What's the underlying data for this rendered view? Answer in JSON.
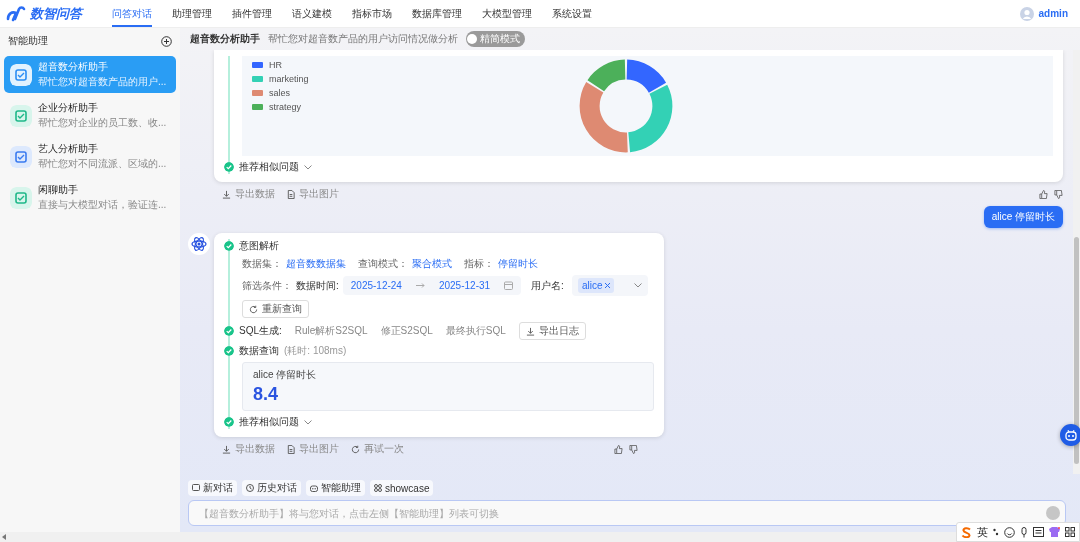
{
  "header": {
    "logo_text": "数智问答",
    "user": "admin",
    "nav": [
      {
        "label": "问答对话",
        "selected": true
      },
      {
        "label": "助理管理",
        "selected": false
      },
      {
        "label": "插件管理",
        "selected": false
      },
      {
        "label": "语义建模",
        "selected": false
      },
      {
        "label": "指标市场",
        "selected": false
      },
      {
        "label": "数据库管理",
        "selected": false
      },
      {
        "label": "大模型管理",
        "selected": false
      },
      {
        "label": "系统设置",
        "selected": false
      }
    ]
  },
  "sidebar": {
    "title": "智能助理",
    "items": [
      {
        "name": "超音数分析助手",
        "description": "帮忙您对超音数产品的用户...",
        "selected": true
      },
      {
        "name": "企业分析助手",
        "description": "帮忙您对企业的员工数、收...",
        "selected": false
      },
      {
        "name": "艺人分析助手",
        "description": "帮忙您对不同流派、区域的...",
        "selected": false
      },
      {
        "name": "闲聊助手",
        "description": "直接与大模型对话，验证连...",
        "selected": false
      }
    ]
  },
  "assistant_header": {
    "title": "超音数分析助手",
    "description": "帮忙您对超音数产品的用户访问情况做分析",
    "toggle": {
      "label": "精简模式",
      "on": false
    }
  },
  "messages": [
    {
      "kind": "chart_answer",
      "legend": [
        {
          "label": "HR",
          "color": "#3366ff"
        },
        {
          "label": "marketing",
          "color": "#33d1b5"
        },
        {
          "label": "sales",
          "color": "#de8a72"
        },
        {
          "label": "strategy",
          "color": "#4cb05a"
        }
      ],
      "recommend": "推荐相似问题",
      "actions": [
        "导出数据",
        "导出图片"
      ]
    },
    {
      "kind": "user",
      "text": "alice 停留时长"
    },
    {
      "kind": "analysis_answer",
      "intent": {
        "title": "意图解析",
        "dataset_label": "数据集：",
        "dataset": "超音数数据集",
        "mode_label": "查询模式：",
        "mode": "聚合模式",
        "metric_label": "指标：",
        "metric": "停留时长",
        "filter_label": "筛选条件：",
        "date_label": "数据时间:",
        "date_start": "2025-12-24",
        "date_end": "2025-12-31",
        "user_label": "用户名:",
        "user_tag": "alice",
        "requery": "重新查询"
      },
      "sql": {
        "title": "SQL生成:",
        "tabs": [
          "Rule解析S2SQL",
          "修正S2SQL",
          "最终执行SQL"
        ],
        "export": "导出日志"
      },
      "query": {
        "title": "数据查询",
        "elapsed": "(耗时: 108ms)",
        "metric_name": "alice 停留时长",
        "value": "8.4"
      },
      "recommend": "推荐相似问题",
      "actions": [
        "导出数据",
        "导出图片",
        "再试一次"
      ]
    }
  ],
  "bottom": {
    "chips": [
      "新对话",
      "历史对话",
      "智能助理",
      "showcase"
    ],
    "placeholder": "【超音数分析助手】将与您对话，点击左侧【智能助理】列表可切换"
  },
  "ime": {
    "label": "英"
  }
}
